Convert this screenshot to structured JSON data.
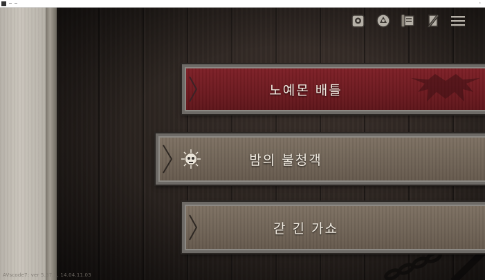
{
  "window": {
    "close_glyph": "›"
  },
  "top_icons": [
    {
      "name": "collection-icon"
    },
    {
      "name": "emblem-icon"
    },
    {
      "name": "scroll-icon"
    },
    {
      "name": "quill-icon"
    },
    {
      "name": "hamburger-menu-icon"
    }
  ],
  "menu": {
    "battle_label": "노예몬 배틀",
    "night_label": "밤의 불청객",
    "songs_label": "갇 긴 가쇼"
  },
  "footer": {
    "version_text": "AVscode7: ver 5.37.3, 14.04.11.03"
  },
  "colors": {
    "battle_red": "#6c1a20",
    "button_brown": "#6f6356",
    "frame_gray": "#6d6a66",
    "wood_dark": "#2a231f",
    "text_light": "#f3ede3"
  }
}
